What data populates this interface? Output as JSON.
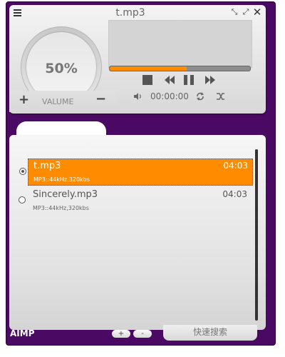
{
  "window": {
    "title": "t.mp3"
  },
  "volume": {
    "percent_label": "50%",
    "label": "VALUME",
    "plus": "+",
    "minus": "−",
    "level": 0.5
  },
  "player": {
    "time": "00:00:00",
    "progress": 0.55
  },
  "playlist": {
    "items": [
      {
        "title": "t.mp3",
        "meta": "MP3::44kHz,320kbs",
        "duration": "04:03",
        "selected": true
      },
      {
        "title": "Sincerely.mp3",
        "meta": "MP3::44kHz,320kbs",
        "duration": "04:03",
        "selected": false
      }
    ]
  },
  "bottom": {
    "app_name": "AIMP",
    "add_label": "+",
    "remove_label": "-",
    "search_label": "快速搜索"
  },
  "colors": {
    "accent": "#ff8c00",
    "frame": "#4a0a63"
  },
  "icons": [
    "menu-icon",
    "minimize-icon",
    "restore-icon",
    "close-icon",
    "stop-icon",
    "rewind-icon",
    "pause-icon",
    "forward-icon",
    "speaker-icon",
    "repeat-icon",
    "shuffle-icon"
  ]
}
